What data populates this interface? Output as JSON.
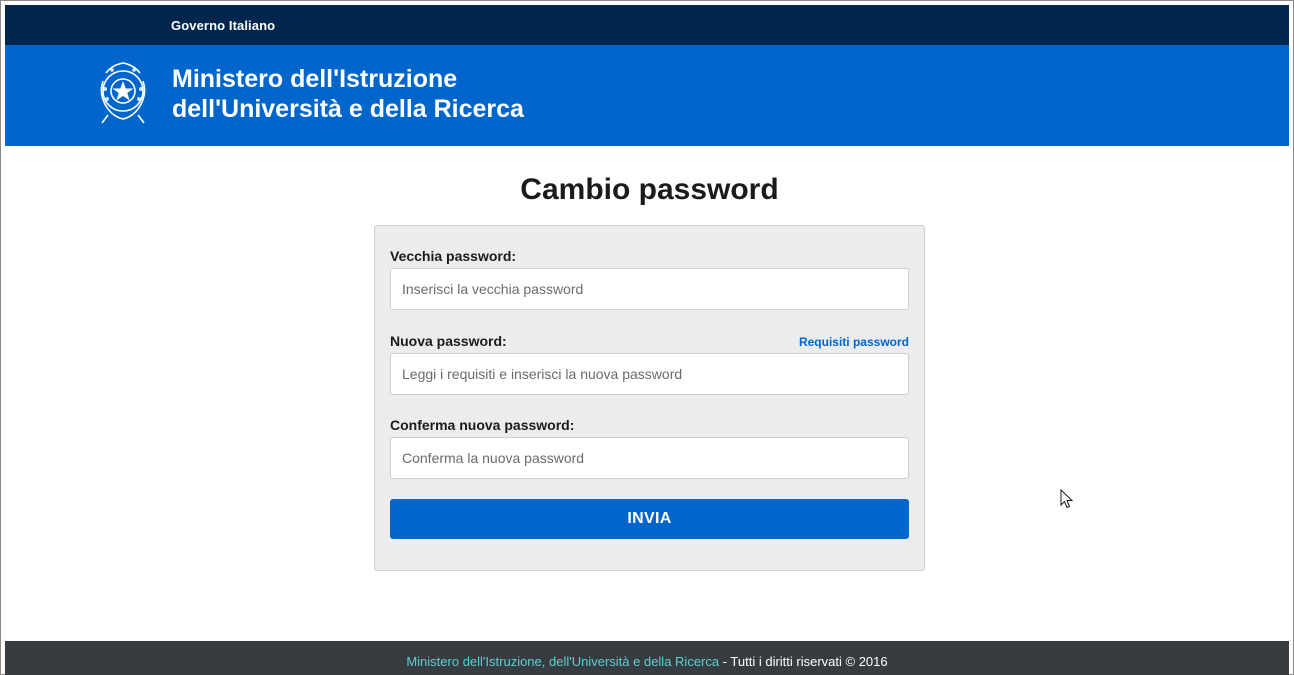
{
  "gov_bar": {
    "label": "Governo Italiano"
  },
  "header": {
    "title_line1": "Ministero dell'Istruzione",
    "title_line2": "dell'Università e della Ricerca",
    "emblem_icon": "italian-republic-emblem-icon"
  },
  "page": {
    "title": "Cambio password"
  },
  "form": {
    "old_password": {
      "label": "Vecchia password:",
      "placeholder": "Inserisci la vecchia password",
      "value": ""
    },
    "new_password": {
      "label": "Nuova password:",
      "placeholder": "Leggi i requisiti e inserisci la nuova password",
      "value": "",
      "requirements_link": "Requisiti password"
    },
    "confirm_password": {
      "label": "Conferma nuova password:",
      "placeholder": "Conferma la nuova password",
      "value": ""
    },
    "submit_label": "INVIA"
  },
  "footer": {
    "ministry": "Ministero dell'Istruzione, dell'Università e della Ricerca",
    "rights": " - Tutti i diritti riservati © 2016"
  },
  "colors": {
    "top_bar": "#00264d",
    "header": "#0066cc",
    "primary_button": "#0066cc",
    "footer": "#373c40",
    "footer_link": "#5ecfd1"
  }
}
